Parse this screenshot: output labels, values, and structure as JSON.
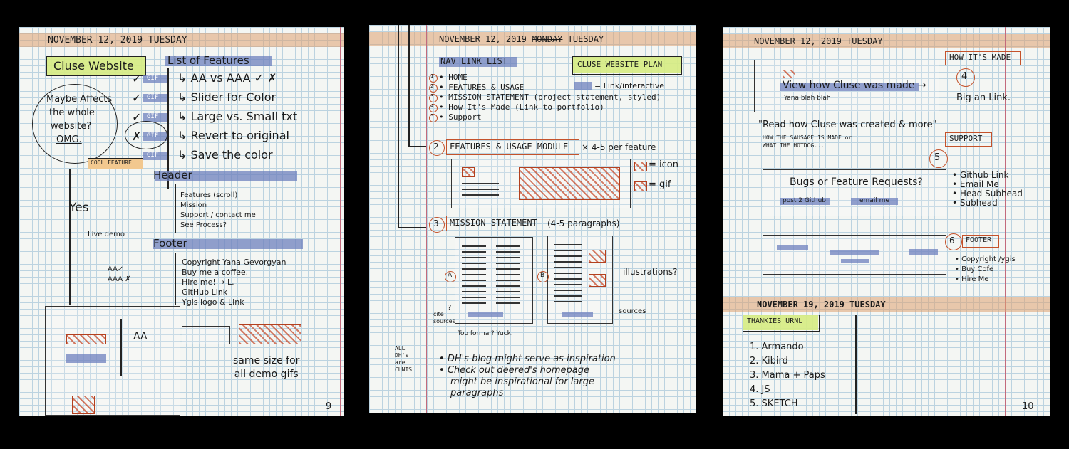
{
  "pages": [
    {
      "date": "NOVEMBER 12, 2019  TUESDAY",
      "project_label": "Cluse Website",
      "features_heading": "List of Features",
      "feature_rows": [
        {
          "check": "✓",
          "tag": "GIF",
          "text": "AA vs AAA ✓ ✗"
        },
        {
          "check": "✓",
          "tag": "GIF",
          "text": "Slider for Color"
        },
        {
          "check": "✓",
          "tag": "GIF",
          "text": "Large vs. Small txt"
        },
        {
          "check": "✗",
          "tag": "GIF",
          "text": "Revert to original"
        },
        {
          "check": "",
          "tag": "GIF",
          "text": "Save the color"
        }
      ],
      "bubble_text": [
        "Maybe Affects",
        "the whole",
        "website?",
        "OMG."
      ],
      "cool_feature": "COOL FEATURE",
      "header_heading": "Header",
      "header_items": [
        "Features (scroll)",
        "Mission",
        "Support / contact me",
        "See Process?"
      ],
      "yes_text": "Yes",
      "live_demo": "Live demo",
      "footer_heading": "Footer",
      "footer_items": [
        "Copyright  Yana Gevorgyan",
        "Buy me a coffee.",
        "Hire me! → L.",
        "GitHub Link",
        "Ygis logo & Link"
      ],
      "aa_notes": [
        "AA✓",
        "AAA ✗"
      ],
      "wire_aa": "AA",
      "same_size": [
        "same size for",
        "all demo gifs"
      ],
      "page_number": "9"
    },
    {
      "date": "NOVEMBER 12, 2019",
      "date_struck": "MONDAY",
      "date_day": "TUESDAY",
      "nav_heading": "NAV LINK LIST",
      "plan_label": "CLUSE WEBSITE PLAN",
      "legend_link": "= Link/interactive",
      "nav_items": [
        {
          "n": "1",
          "text": "HOME"
        },
        {
          "n": "2",
          "text": "FEATURES & USAGE"
        },
        {
          "n": "3",
          "text": "MISSION STATEMENT  (project statement, styled)"
        },
        {
          "n": "4",
          "text": "How It's Made  (Link to portfolio)"
        },
        {
          "n": "5",
          "text": "Support"
        }
      ],
      "module_num": "2",
      "module_label": "FEATURES & USAGE MODULE",
      "module_suffix": "× 4-5 per feature",
      "icon_legend": "= icon",
      "gif_legend": "= gif",
      "mission_num": "3",
      "mission_label": "MISSION STATEMENT",
      "mission_suffix": "(4-5 paragraphs)",
      "option_a": "A",
      "option_b": "B",
      "illustrations": "illustrations?",
      "cite_sources": [
        "cite",
        "sources"
      ],
      "cite_q": "?",
      "sources": "sources",
      "too_formal": [
        "Too formal?",
        "Yuck."
      ],
      "all_dhs": [
        "ALL",
        "DH's",
        "are",
        "CUNTS"
      ],
      "notes": [
        "DH's blog might serve as inspiration",
        "Check out deered's homepage",
        "might be inspirational for large",
        "paragraphs"
      ]
    },
    {
      "date": "NOVEMBER 12, 2019  TUESDAY",
      "how_made": "HOW IT'S MADE",
      "how_num": "4",
      "view_link": "View how Cluse was made →",
      "yana_blah": "Yana blah blah",
      "big_link": "Big an Link.",
      "quote": "\"Read how Cluse was created & more\"",
      "sausage": [
        "HOW THE SAUSAGE IS MADE  or",
        "WHAT THE HOTDOG..."
      ],
      "support_label": "SUPPORT",
      "support_num": "5",
      "bugs": "Bugs or Feature Requests?",
      "post_github": "post 2 Github",
      "email_me": "email me",
      "support_items": [
        "Github Link",
        "Email Me",
        "Head Subhead",
        "Subhead"
      ],
      "footer_num": "6",
      "footer_label": "FOOTER",
      "footer_items": [
        "Copyright /ygis",
        "Buy Cofe",
        "Hire Me"
      ],
      "date2": "NOVEMBER 19, 2019  TUESDAY",
      "thankies": "THANKIES URNL",
      "thanks_list": [
        "1. Armando",
        "2. Kibird",
        "3. Mama + Paps",
        "4. JS",
        "5. SKETCH"
      ],
      "page_number": "10"
    }
  ]
}
